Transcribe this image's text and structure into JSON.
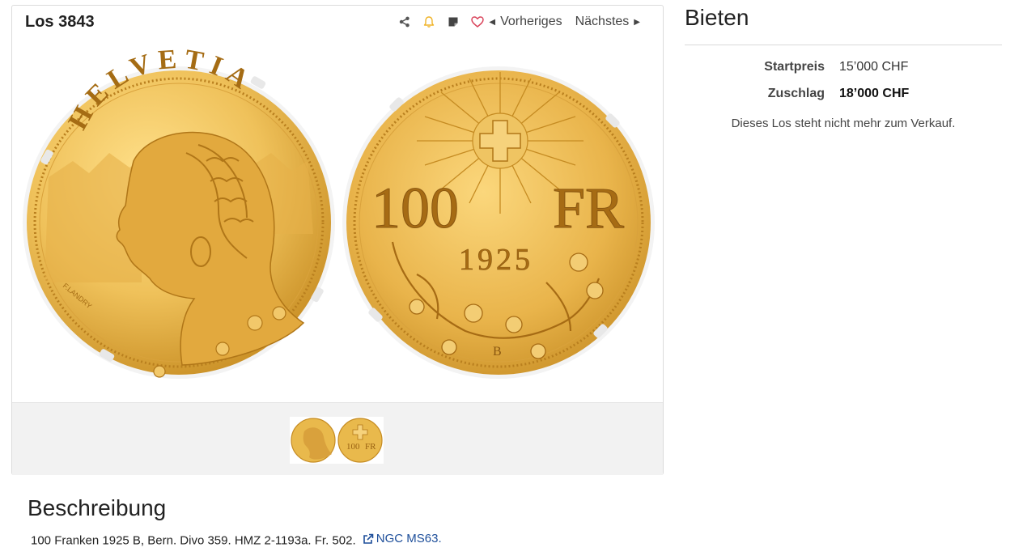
{
  "lot": {
    "title": "Los 3843",
    "prev_label": "Vorheriges",
    "next_label": "Nächstes",
    "coin": {
      "obverse_legend": "HELVETIA",
      "engraver": "F.LANDRY",
      "denomination_number": "100",
      "denomination_unit": "FR",
      "year": "1925",
      "mint_mark": "B"
    }
  },
  "bidding": {
    "title": "Bieten",
    "start_label": "Startpreis",
    "start_value": "15’000 CHF",
    "hammer_label": "Zuschlag",
    "hammer_value": "18’000 CHF",
    "status": "Dieses Los steht nicht mehr zum Verkauf."
  },
  "description": {
    "title": "Beschreibung",
    "text": "100 Franken 1925 B, Bern. Divo 359. HMZ 2-1193a. Fr. 502.",
    "link_label": "NGC MS63."
  },
  "icons": [
    "share-icon",
    "bell-icon",
    "note-icon",
    "heart-icon",
    "caret-left-icon",
    "caret-right-icon",
    "external-link-icon"
  ],
  "colors": {
    "gold": "#e8b84a",
    "bell": "#f0b429",
    "heart": "#d9435a",
    "link": "#1d4e9a"
  }
}
